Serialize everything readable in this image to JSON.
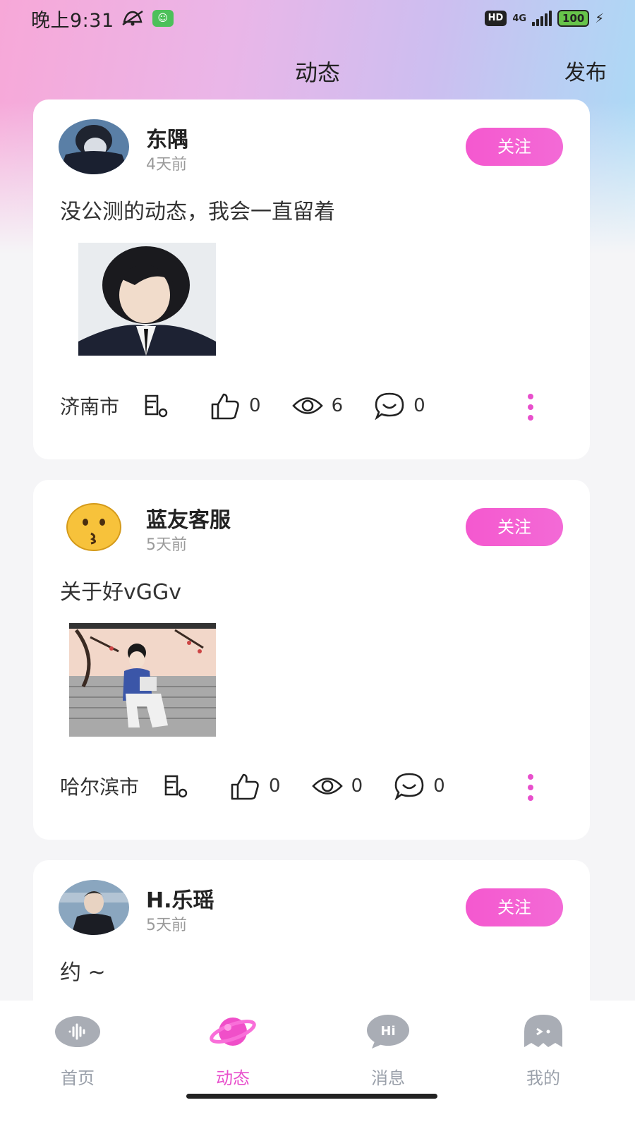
{
  "status_bar": {
    "time": "晚上9:31",
    "hd": "HD",
    "network": "4G",
    "battery": "100"
  },
  "header": {
    "title": "动态",
    "publish_label": "发布"
  },
  "posts": [
    {
      "username": "东隅",
      "time_ago": "4天前",
      "follow_label": "关注",
      "text": "没公测的动态，我会一直留着",
      "city": "济南市",
      "likes": "0",
      "views": "6",
      "comments": "0"
    },
    {
      "username": "蓝友客服",
      "time_ago": "5天前",
      "follow_label": "关注",
      "text": "关于好vGGv",
      "city": "哈尔滨市",
      "likes": "0",
      "views": "0",
      "comments": "0"
    },
    {
      "username": "H.乐瑶",
      "time_ago": "5天前",
      "follow_label": "关注",
      "text": "约 ~"
    }
  ],
  "tabbar": {
    "tabs": [
      {
        "label": "首页",
        "icon": "home-icon"
      },
      {
        "label": "动态",
        "icon": "planet-icon"
      },
      {
        "label": "消息",
        "icon": "message-icon"
      },
      {
        "label": "我的",
        "icon": "profile-icon"
      }
    ],
    "active_color": "#e84fcc",
    "inactive_color": "#9aa0aa"
  },
  "colors": {
    "accent": "#f458cf"
  }
}
